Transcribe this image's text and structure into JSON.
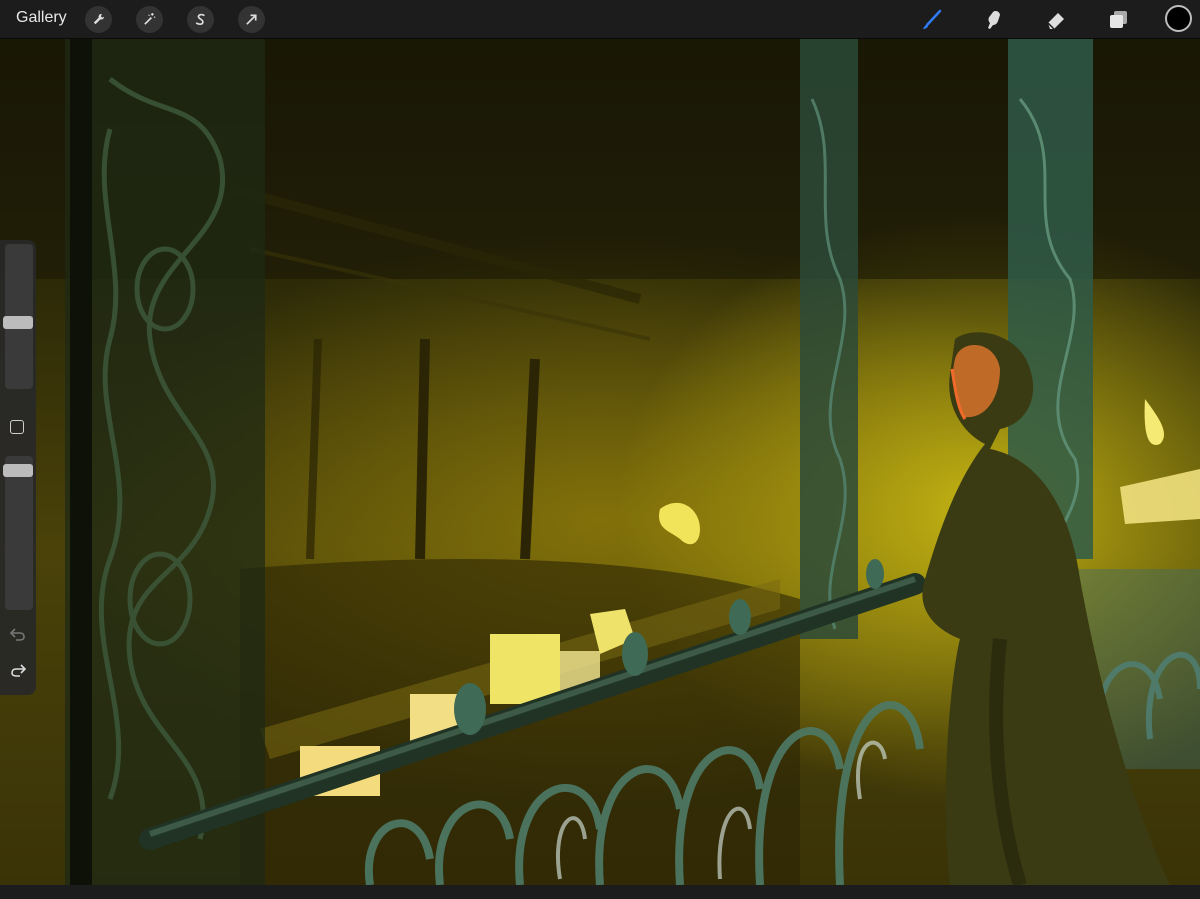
{
  "toolbar": {
    "gallery_label": "Gallery",
    "left_tools": [
      {
        "name": "wrench-icon"
      },
      {
        "name": "magic-wand-icon"
      },
      {
        "name": "selection-s-icon"
      },
      {
        "name": "transform-arrow-icon"
      }
    ],
    "right_tools": [
      {
        "name": "brush-icon",
        "active": true
      },
      {
        "name": "smudge-icon"
      },
      {
        "name": "eraser-icon"
      },
      {
        "name": "layers-icon"
      }
    ],
    "current_color": "#000000",
    "active_color_accent": "#2f7bf5"
  },
  "sidebar": {
    "brush_size_level": 0.53,
    "opacity_level": 0.2,
    "modify_button": "square-icon",
    "undo_icon": "undo-icon",
    "redo_icon": "redo-icon"
  },
  "canvas": {
    "description_palette": [
      "#1b1a06",
      "#4a4209",
      "#d6c414",
      "#2f4a34",
      "#f2e27a"
    ]
  }
}
